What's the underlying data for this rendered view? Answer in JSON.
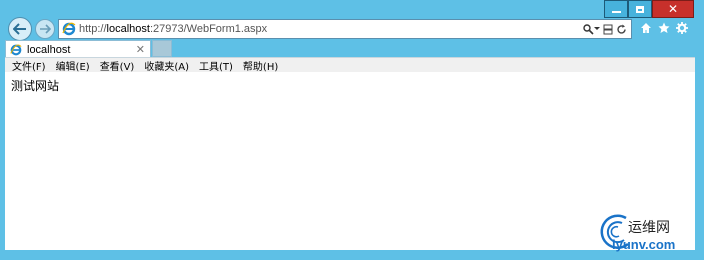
{
  "window": {
    "caption": {
      "minimize": "minimize",
      "maximize": "maximize",
      "close": "close"
    }
  },
  "navigation": {
    "url_prefix": "http://",
    "url_host": "localhost",
    "url_rest": ":27973/WebForm1.aspx"
  },
  "tabs": [
    {
      "title": "localhost",
      "close": "✕"
    }
  ],
  "menu": [
    {
      "label": "文件(F)"
    },
    {
      "label": "编辑(E)"
    },
    {
      "label": "查看(V)"
    },
    {
      "label": "收藏夹(A)"
    },
    {
      "label": "工具(T)"
    },
    {
      "label": "帮助(H)"
    }
  ],
  "page": {
    "body_text": "测试网站"
  },
  "watermark": {
    "top": "运维网",
    "bottom": "iyunv.com"
  },
  "colors": {
    "frame": "#5ec0e6",
    "close_button": "#c7302b"
  }
}
